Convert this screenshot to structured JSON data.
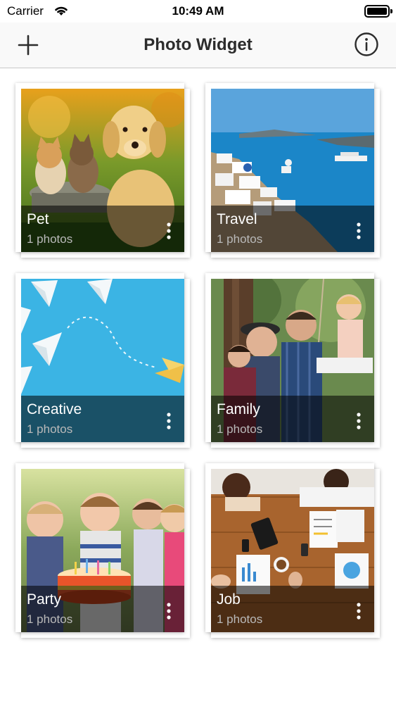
{
  "status_bar": {
    "carrier": "Carrier",
    "time": "10:49 AM"
  },
  "nav": {
    "title": "Photo Widget",
    "add_icon": "plus-icon",
    "info_icon": "info-circle-icon"
  },
  "albums": [
    {
      "title": "Pet",
      "count": "1 photos"
    },
    {
      "title": "Travel",
      "count": "1 photos"
    },
    {
      "title": "Creative",
      "count": "1 photos"
    },
    {
      "title": "Family",
      "count": "1 photos"
    },
    {
      "title": "Party",
      "count": "1 photos"
    },
    {
      "title": "Job",
      "count": "1 photos"
    }
  ],
  "colors": {
    "accent": "#2c2c2c",
    "overlay": "#000000",
    "subtitle": "#b9b9b9"
  }
}
